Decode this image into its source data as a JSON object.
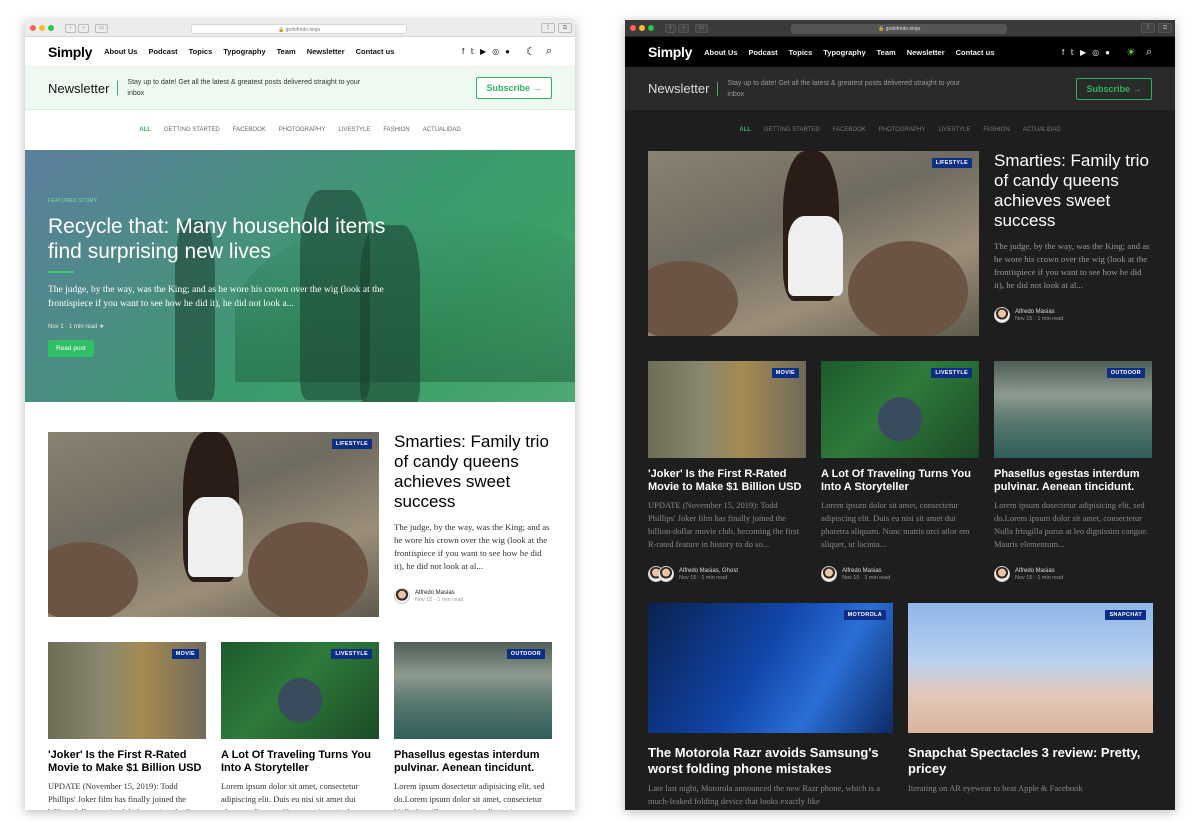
{
  "browser": {
    "url": "godofredo.ninja"
  },
  "site": {
    "logo": "Simply",
    "nav": [
      "About Us",
      "Podcast",
      "Topics",
      "Typography",
      "Team",
      "Newsletter",
      "Contact us"
    ]
  },
  "newsletter": {
    "title": "Newsletter",
    "text": "Stay up to date! Get all the latest & greatest posts delivered straight to your inbox",
    "button": "Subscribe →"
  },
  "tags": [
    "ALL",
    "GETTING STARTED",
    "FACEBOOK",
    "PHOTOGRAPHY",
    "LIVESTYLE",
    "FASHION",
    "ACTUALIDAD"
  ],
  "featured": {
    "label": "FEATURED STORY",
    "title": "Recycle that: Many household items find surprising new lives",
    "excerpt": "The judge, by the way, was the King; and as he wore his crown over the wig (look at the frontispiece if you want to see how he did it), he did not look a...",
    "meta": "Nov 1 · 1 min read ★",
    "button": "Read post"
  },
  "big_post": {
    "tag": "LIFESTYLE",
    "title": "Smarties: Family trio of candy queens achieves sweet success",
    "excerpt": "The judge, by the way, was the King; and as he wore his crown over the wig (look at the frontispiece if you want to see how he did it), he did not look at al...",
    "author": "Alfredo Masias",
    "meta": "Nov 15 · 1 min read"
  },
  "cards": [
    {
      "tag": "MOVIE",
      "title": "'Joker' Is the First R-Rated Movie to Make $1 Billion USD",
      "excerpt": "UPDATE (November 15, 2019): Todd Phillips' Joker film has finally joined the billion-dollar movie club, becoming the first R-rated feature in history to do so...",
      "author": "Alfredo Masias, Ghost",
      "meta": "Nov 15 · 1 min read"
    },
    {
      "tag": "LIVESTYLE",
      "title": "A Lot Of Traveling Turns You Into A Storyteller",
      "excerpt": "Lorem ipsum dolor sit amet, consectetur adipiscing elit. Duis eu nisi sit amet dui pharetra aliquam. Nunc mattis orci atlor em aliquet, ut lacinia...",
      "author": "Alfredo Masias",
      "meta": "Nov 15 · 1 min read"
    },
    {
      "tag": "OUTDOOR",
      "title": "Phasellus egestas interdum pulvinar. Aenean tincidunt.",
      "excerpt": "Lorem ipsum dosectetur adipisicing elit, sed do.Lorem ipsum dolor sit amet, consectetur Nulla fringilla purus at leo dignissim congue. Mauris elementum...",
      "author": "Alfredo Masias",
      "meta": "Nov 15 · 1 min read"
    }
  ],
  "wide_cards": [
    {
      "tag": "MOTOROLA",
      "title": "The Motorola Razr avoids Samsung's worst folding phone mistakes",
      "excerpt": "Late last night, Motorola announced the new Razr phone, which is a much-leaked folding device that looks exactly like"
    },
    {
      "tag": "SNAPCHAT",
      "title": "Snapchat Spectacles 3 review: Pretty, pricey",
      "excerpt": "Iterating on AR eyewear to beat Apple & Facebook"
    }
  ],
  "icons": [
    "facebook-icon",
    "twitter-icon",
    "youtube-icon",
    "instagram-icon",
    "github-icon",
    "moon-icon",
    "sun-icon",
    "search-icon"
  ],
  "colors": {
    "accent": "#2fb361",
    "badge": "#0c2e86",
    "dark_bg": "#1e1e1e",
    "light_bg": "#ffffff"
  }
}
